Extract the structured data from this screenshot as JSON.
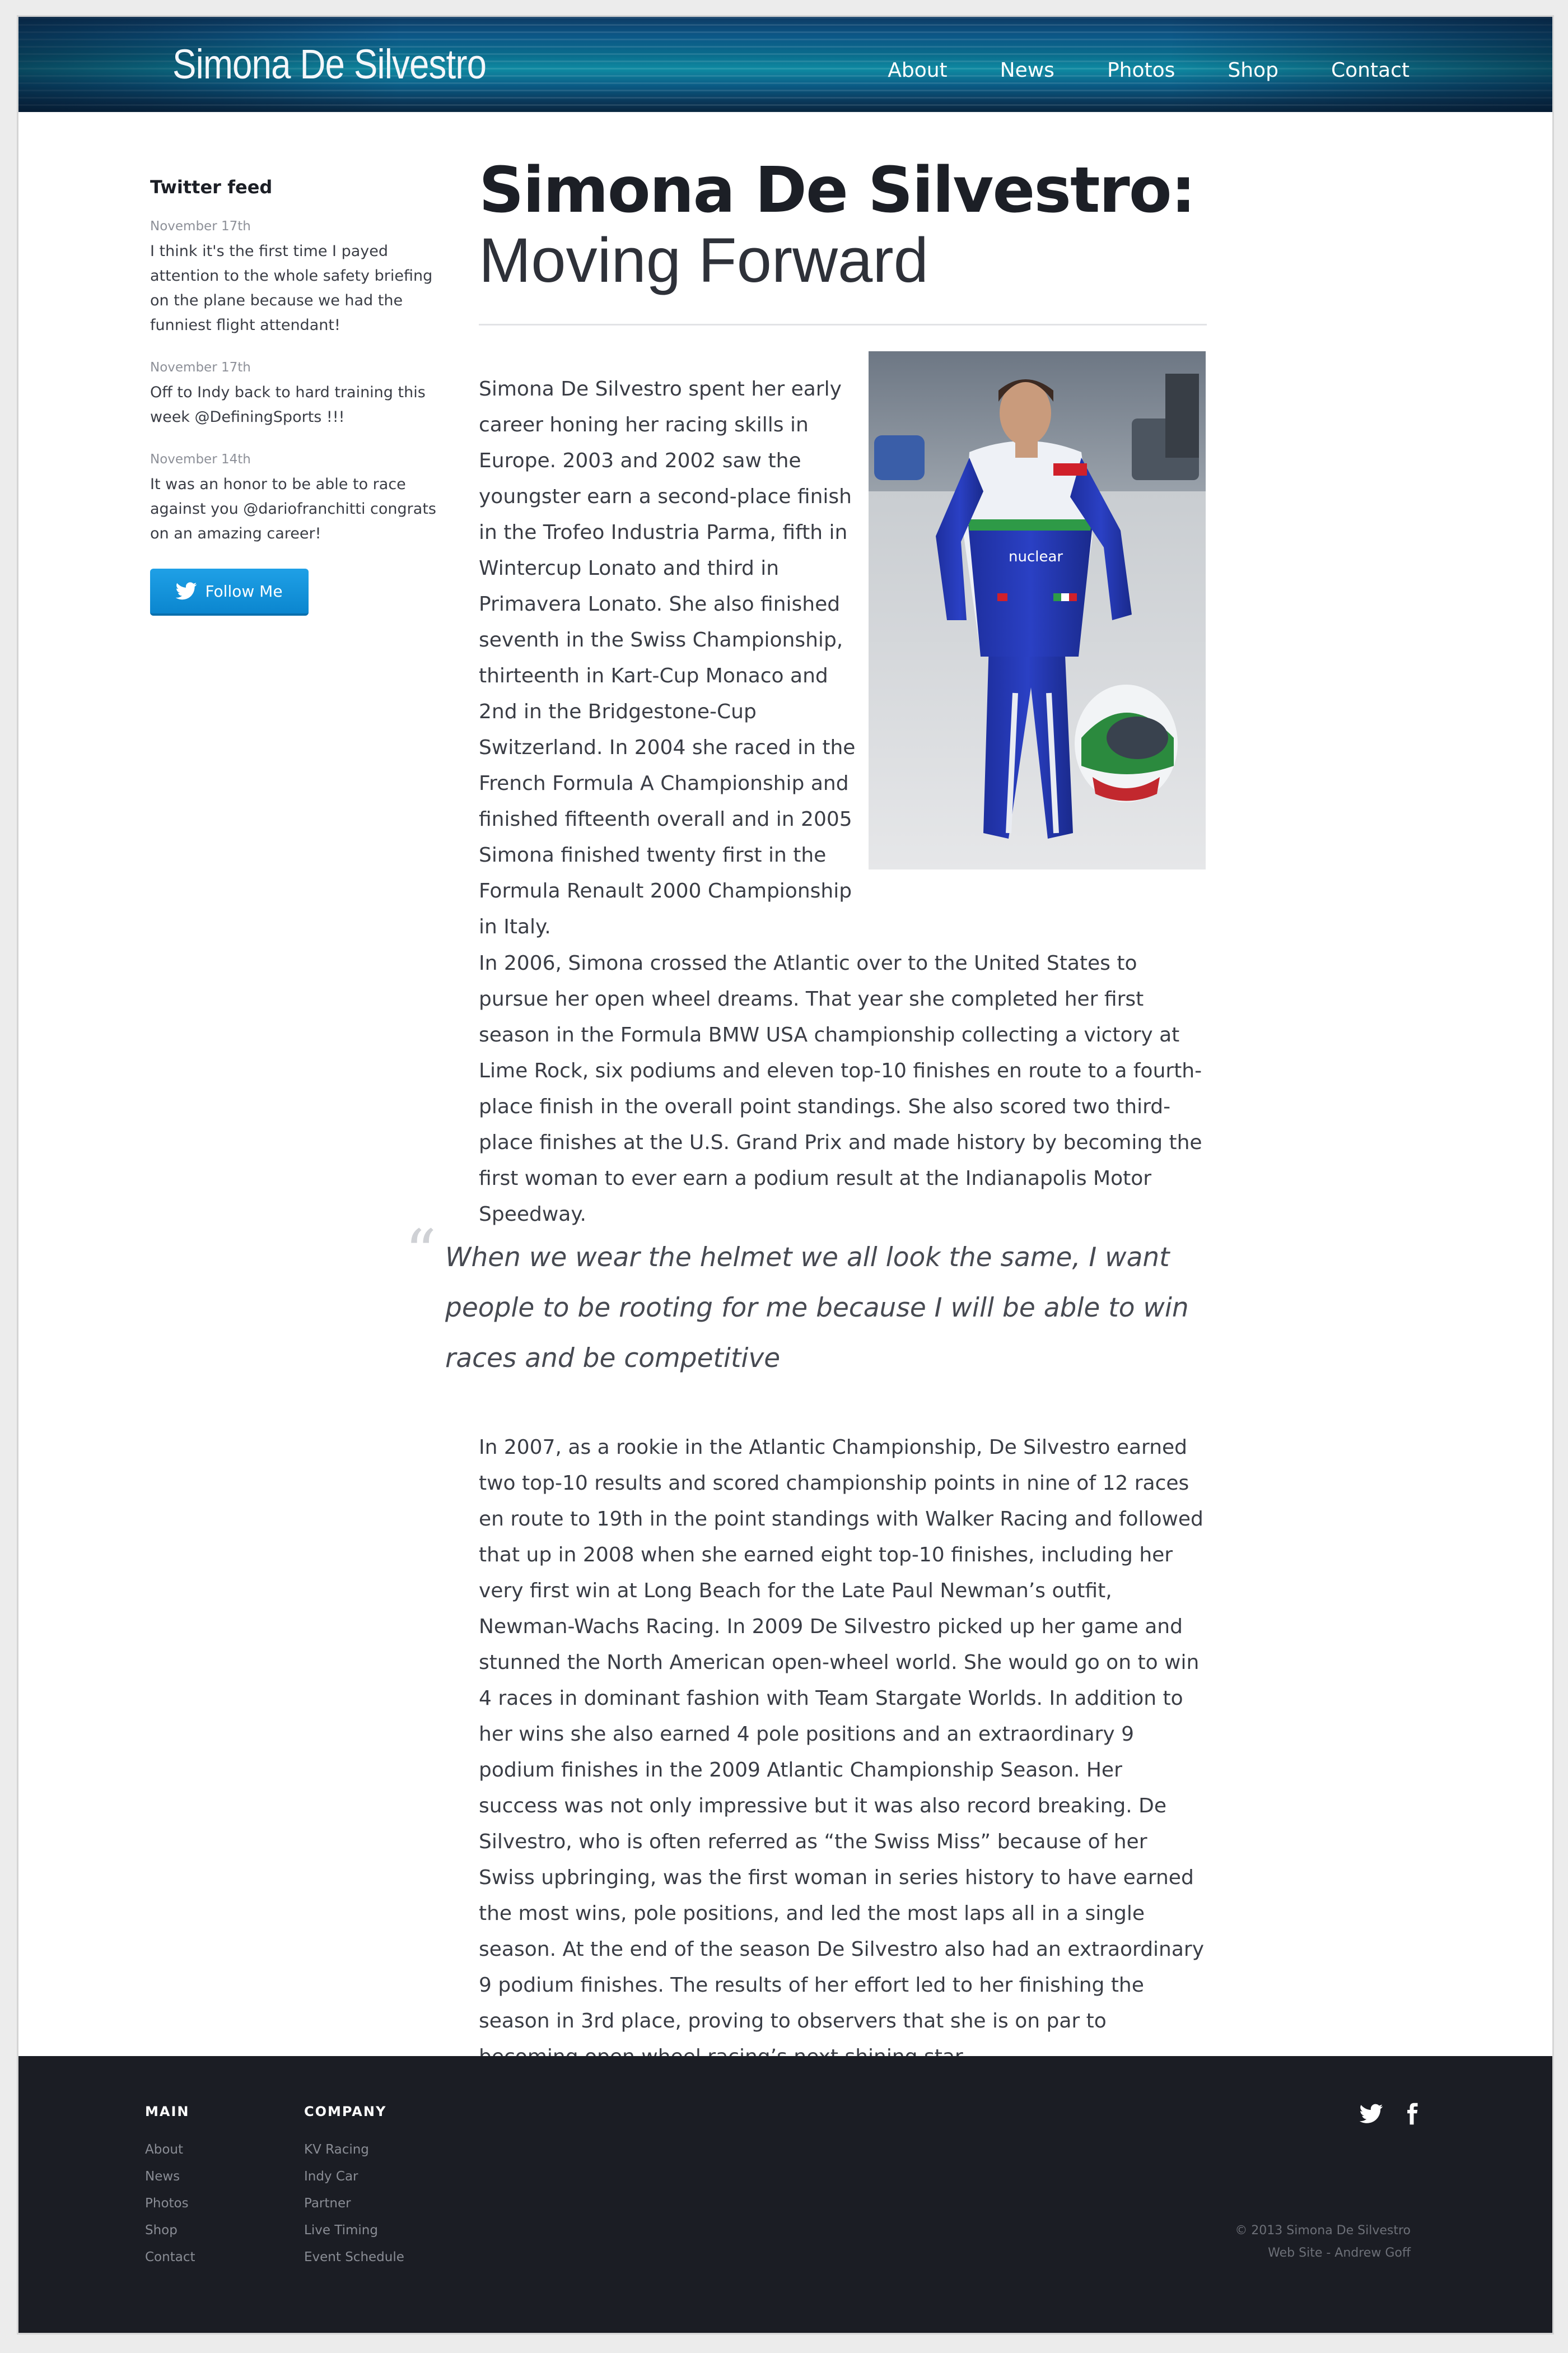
{
  "header": {
    "logo": "Simona De Silvestro",
    "nav": [
      "About",
      "News",
      "Photos",
      "Shop",
      "Contact"
    ]
  },
  "sidebar": {
    "title": "Twitter feed",
    "tweets": [
      {
        "date": "November 17th",
        "text": "I think it's the first time I payed attention to the whole safety briefing on the plane because we had the funniest flight attendant!"
      },
      {
        "date": "November 17th",
        "text": "Off to Indy back to hard training this week @DefiningSports !!!"
      },
      {
        "date": "November 14th",
        "text": "It was an honor to be able to race against you @dariofranchitti congrats on an amazing career!"
      }
    ],
    "follow_label": "Follow Me"
  },
  "article": {
    "title_strong": "Simona De Silvestro:",
    "title_light": "Moving Forward",
    "paragraph1": "Simona De Silvestro spent her early career honing her racing skills in Europe. 2003 and 2002 saw the youngster earn a second-place finish in the Trofeo Industria Parma, fifth in Wintercup Lonato and third in Primavera Lonato. She also finished seventh in the Swiss Championship, thirteenth in Kart-Cup Monaco and 2nd in the Bridgestone-Cup Switzerland. In 2004 she raced in the French Formula A Championship and finished fifteenth overall and in 2005 Simona finished twenty first in the Formula Renault 2000 Championship in Italy.",
    "paragraph2": "In 2006, Simona crossed the Atlantic over to the United States to pursue her open wheel dreams. That year she completed her first season in the Formula BMW USA championship collecting a victory at Lime Rock, six podiums and eleven top-10 finishes en route to a fourth-place finish in the overall point standings. She also scored two third-place finishes at the U.S. Grand Prix and made history by becoming the first woman to ever earn a podium result at the Indianapolis Motor Speedway.",
    "quote": "When we wear the helmet we all look the same, I want people to be rooting for me because I will be able to win races and be competitive",
    "paragraph3": "In 2007, as a rookie in the Atlantic Championship, De Silvestro earned two top-10 results and scored championship points in nine of 12 races en route to 19th in the point standings with Walker Racing and followed that up in 2008 when she earned eight top-10 finishes, including her very first win at Long Beach for the Late Paul Newman’s outfit, Newman-Wachs Racing. In 2009 De Silvestro picked up her game and stunned the North American open-wheel world. She would go on to win 4 races in dominant fashion with Team Stargate Worlds. In addition to her wins she also earned 4 pole positions and an extraordinary 9 podium finishes in the 2009 Atlantic Championship Season. Her success was not only impressive but it was also record breaking. De Silvestro, who is often referred as “the Swiss Miss” because of her Swiss upbringing, was the first woman in series history to have earned the most wins, pole positions, and led the most laps all in a single season. At the end of the season De Silvestro also had an extraordinary 9 podium finishes. The results of her effort led to her finishing the season in 3rd place, proving to observers that she is on par to becoming open wheel racing’s next shining star.",
    "photo_badge": "nuclear"
  },
  "footer": {
    "main_title": "MAIN",
    "main_links": [
      "About",
      "News",
      "Photos",
      "Shop",
      "Contact"
    ],
    "company_title": "COMPANY",
    "company_links": [
      "KV Racing",
      "Indy Car",
      "Partner",
      "Live Timing",
      "Event Schedule"
    ],
    "copyright": "© 2013 Simona De Silvestro",
    "credit": "Web Site - Andrew Goff",
    "social_icons": [
      "twitter-icon",
      "facebook-icon"
    ]
  },
  "colors": {
    "header_blue": "#0a6c8c",
    "follow_button": "#1094dc",
    "footer_bg": "#1b1d24"
  }
}
